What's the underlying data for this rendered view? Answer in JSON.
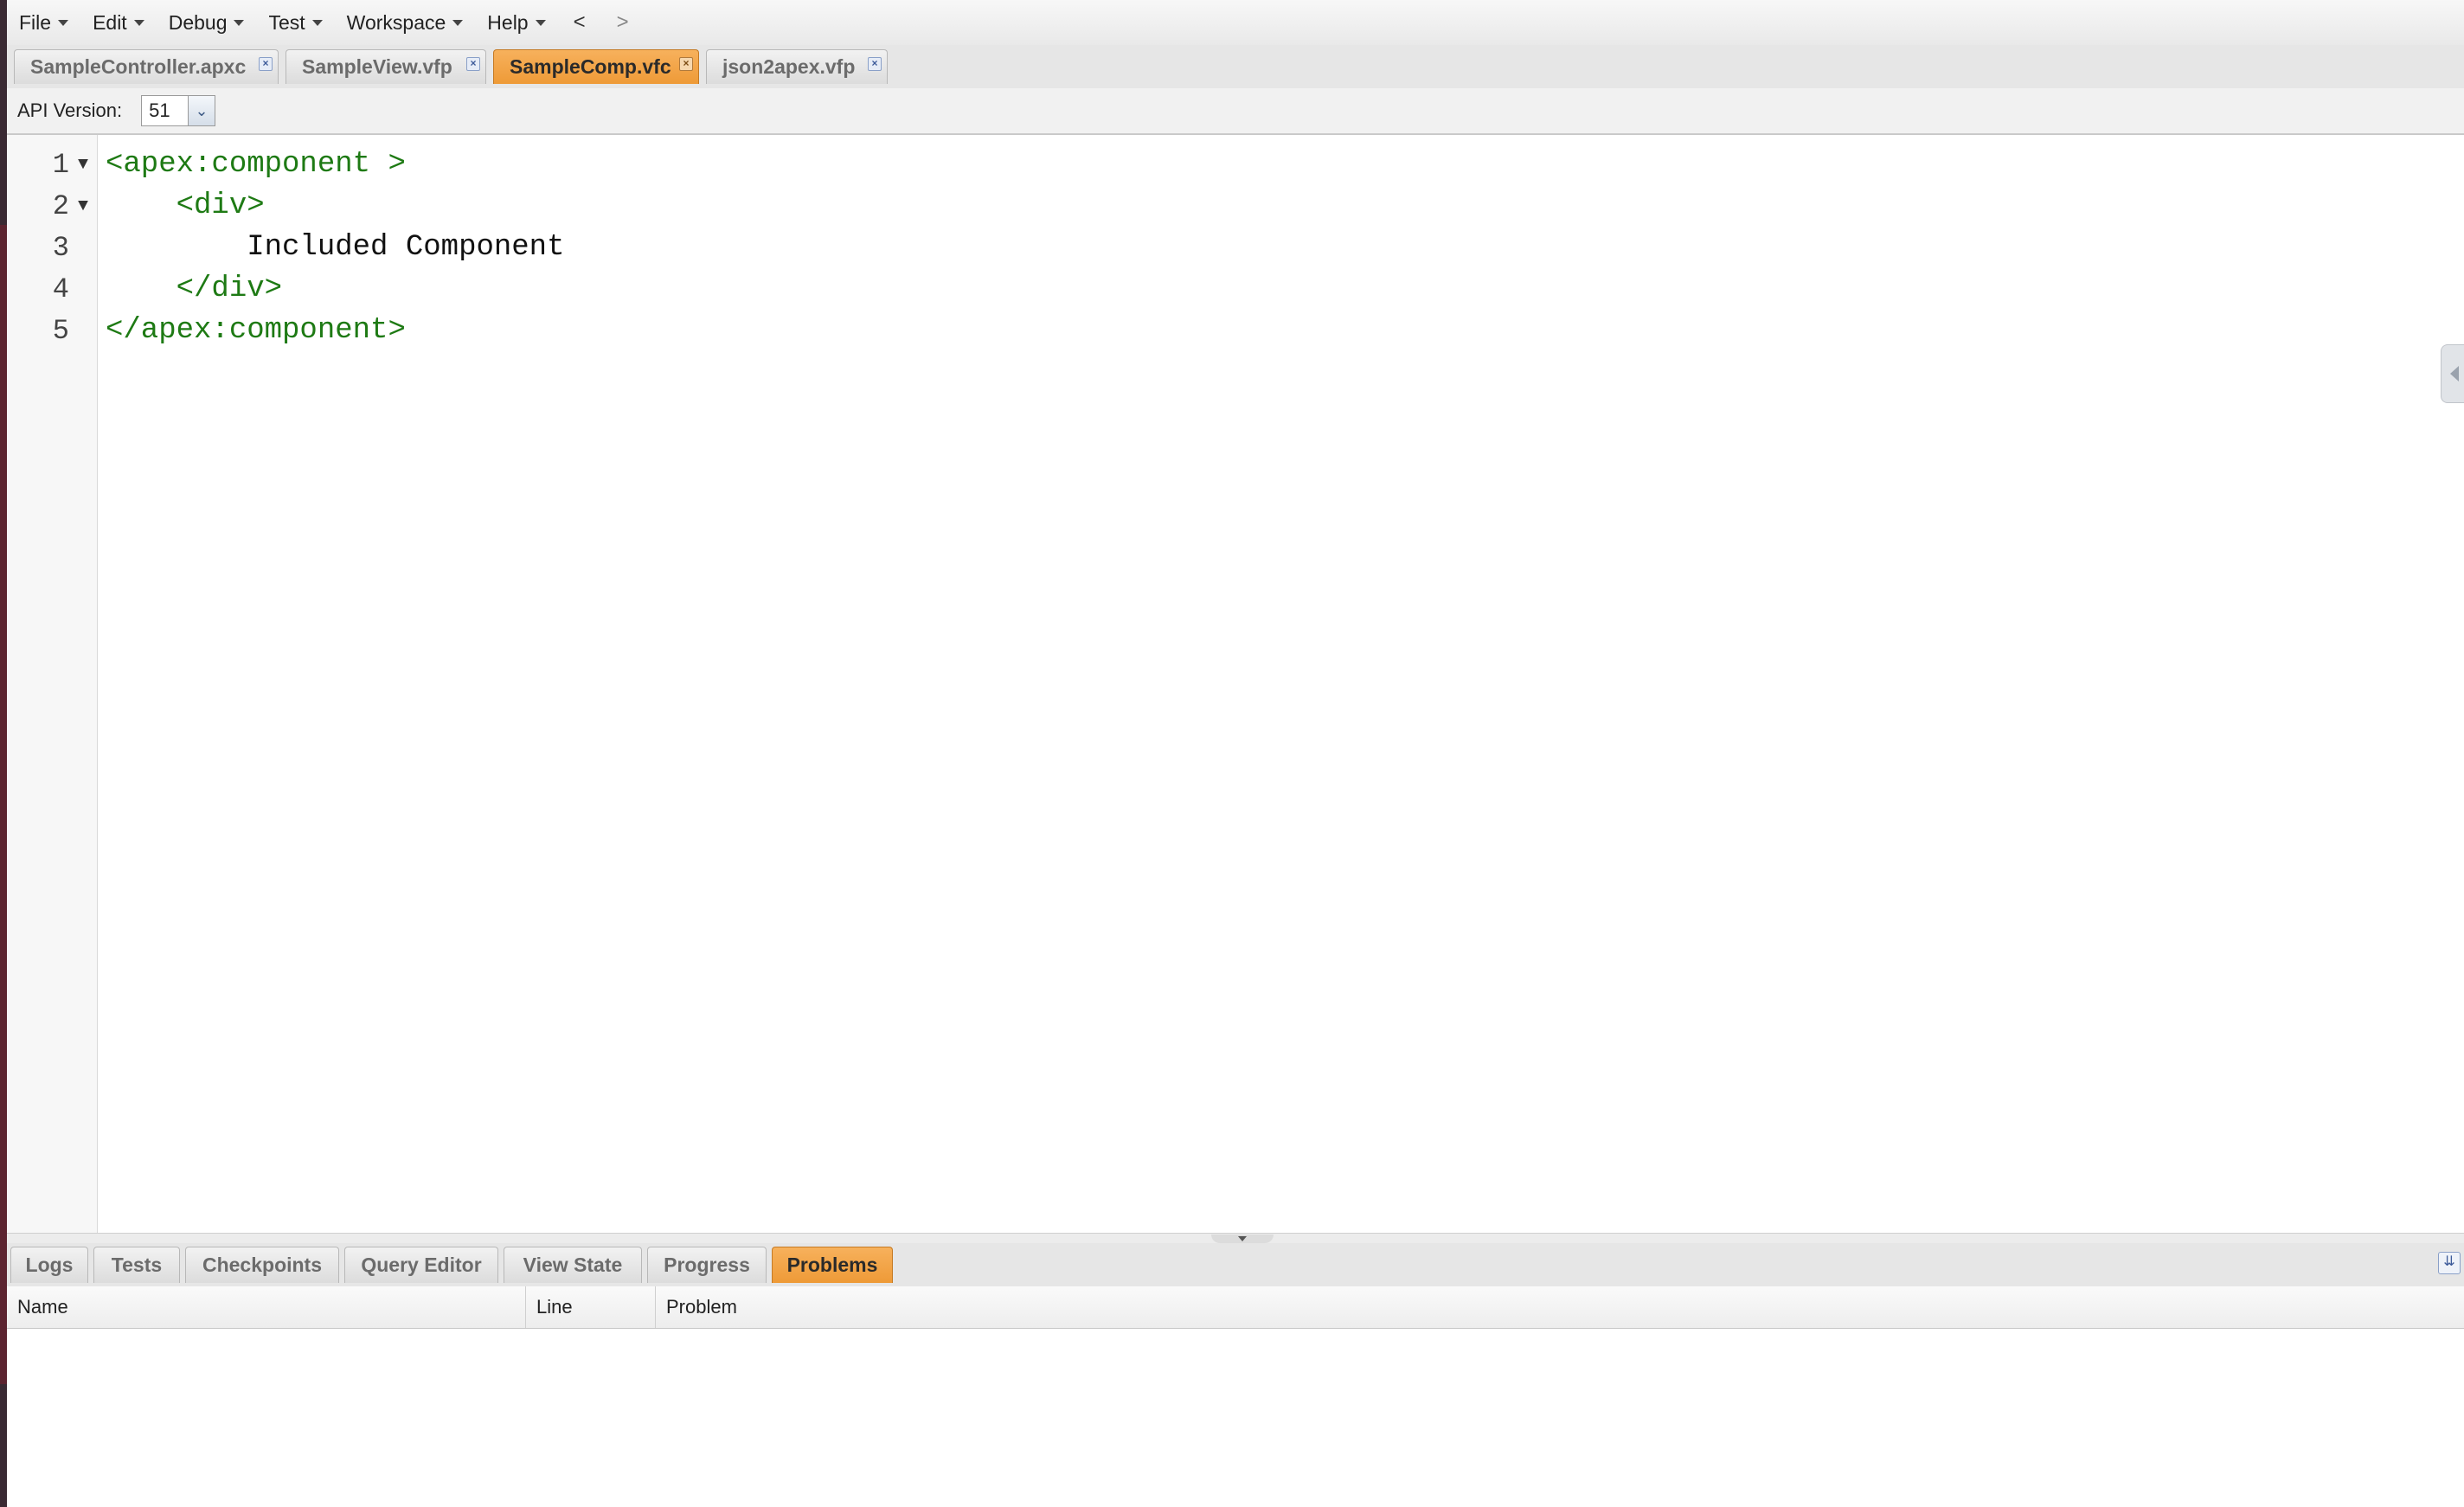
{
  "menu": {
    "items": [
      "File",
      "Edit",
      "Debug",
      "Test",
      "Workspace",
      "Help"
    ],
    "back_label": "<",
    "forward_label": ">"
  },
  "tabs": [
    {
      "label": "SampleController.apxc",
      "active": false
    },
    {
      "label": "SampleView.vfp",
      "active": false
    },
    {
      "label": "SampleComp.vfc",
      "active": true
    },
    {
      "label": "json2apex.vfp",
      "active": false
    }
  ],
  "tab_close_glyph": "×",
  "api": {
    "label": "API Version:",
    "value": "51"
  },
  "editor": {
    "lines": [
      {
        "number": "1",
        "fold": "▼",
        "text": "<apex:component >",
        "kind": "tag"
      },
      {
        "number": "2",
        "fold": "▼",
        "text": "    <div>",
        "kind": "tag"
      },
      {
        "number": "3",
        "fold": "",
        "text": "        Included Component",
        "kind": "plain"
      },
      {
        "number": "4",
        "fold": "",
        "text": "    </div>",
        "kind": "tag"
      },
      {
        "number": "5",
        "fold": "",
        "text": "</apex:component>",
        "kind": "tag"
      }
    ]
  },
  "bottom_tabs": [
    {
      "label": "Logs",
      "active": false
    },
    {
      "label": "Tests",
      "active": false
    },
    {
      "label": "Checkpoints",
      "active": false
    },
    {
      "label": "Query Editor",
      "active": false
    },
    {
      "label": "View State",
      "active": false
    },
    {
      "label": "Progress",
      "active": false
    },
    {
      "label": "Problems",
      "active": true
    }
  ],
  "problems_grid": {
    "columns": [
      "Name",
      "Line",
      "Problem"
    ],
    "rows": []
  },
  "colors": {
    "active_tab": "#ee9a37",
    "tag_text": "#1e7a14"
  }
}
